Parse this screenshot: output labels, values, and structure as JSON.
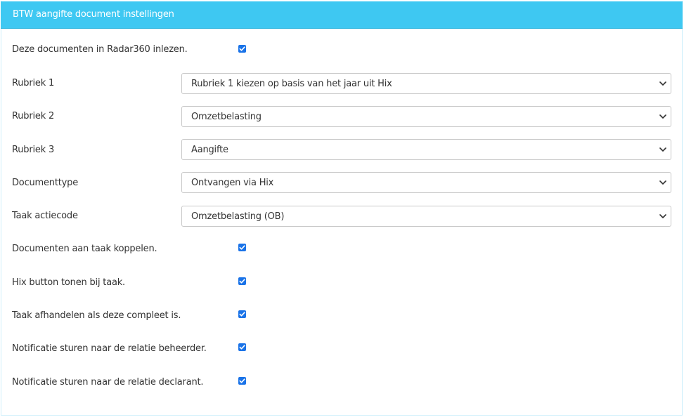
{
  "panel": {
    "title": "BTW aangifte document instellingen"
  },
  "settings": {
    "read_documents": {
      "label": "Deze documenten in Radar360 inlezen.",
      "checked": true
    },
    "rubriek1": {
      "label": "Rubriek 1",
      "value": "Rubriek 1 kiezen op basis van het jaar uit Hix"
    },
    "rubriek2": {
      "label": "Rubriek 2",
      "value": "Omzetbelasting"
    },
    "rubriek3": {
      "label": "Rubriek 3",
      "value": "Aangifte"
    },
    "documenttype": {
      "label": "Documenttype",
      "value": "Ontvangen via Hix"
    },
    "taak_actiecode": {
      "label": "Taak actiecode",
      "value": "Omzetbelasting (OB)"
    },
    "link_documents": {
      "label": "Documenten aan taak koppelen.",
      "checked": true
    },
    "hix_button": {
      "label": "Hix button tonen bij taak.",
      "checked": true
    },
    "complete_task": {
      "label": "Taak afhandelen als deze compleet is.",
      "checked": true
    },
    "notify_manager": {
      "label": "Notificatie sturen naar de relatie beheerder.",
      "checked": true
    },
    "notify_declarant": {
      "label": "Notificatie sturen naar de relatie declarant.",
      "checked": true
    }
  },
  "colors": {
    "header": "#3ec8f2",
    "checkbox": "#1a73e8"
  }
}
